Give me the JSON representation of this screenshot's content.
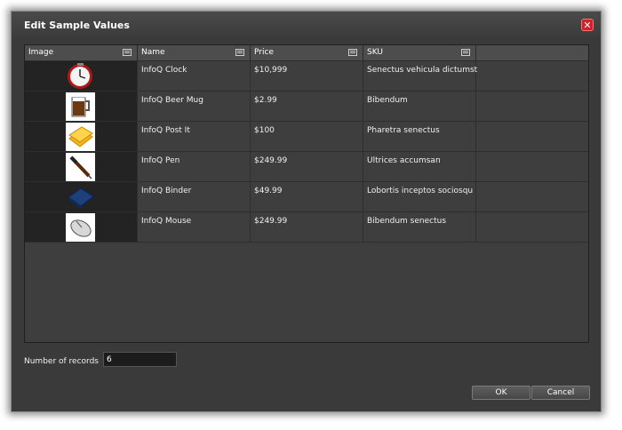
{
  "dialog": {
    "title": "Edit Sample Values",
    "close_symbol": "✕"
  },
  "columns": [
    {
      "label": "Image"
    },
    {
      "label": "Name"
    },
    {
      "label": "Price"
    },
    {
      "label": "SKU"
    }
  ],
  "rows": [
    {
      "image_icon": "clock-icon",
      "name": "InfoQ Clock",
      "price": "$10,999",
      "sku": "Senectus vehicula dictumst"
    },
    {
      "image_icon": "beer-mug-icon",
      "name": "InfoQ Beer Mug",
      "price": "$2.99",
      "sku": "Bibendum"
    },
    {
      "image_icon": "post-it-icon",
      "name": "InfoQ Post It",
      "price": "$100",
      "sku": "Pharetra senectus"
    },
    {
      "image_icon": "pen-icon",
      "name": "InfoQ Pen",
      "price": "$249.99",
      "sku": "Ultrices accumsan"
    },
    {
      "image_icon": "binder-icon",
      "name": "InfoQ Binder",
      "price": "$49.99",
      "sku": "Lobortis inceptos sociosqu"
    },
    {
      "image_icon": "mouse-icon",
      "name": "InfoQ Mouse",
      "price": "$249.99",
      "sku": "Bibendum senectus"
    }
  ],
  "footer": {
    "records_label": "Number of records",
    "records_value": "6",
    "ok_label": "OK",
    "cancel_label": "Cancel"
  },
  "colors": {
    "dialog_bg": "#3a3a3a",
    "header_bg": "#4d4d4d",
    "image_col_bg": "#232323",
    "close_red": "#d0202a"
  }
}
